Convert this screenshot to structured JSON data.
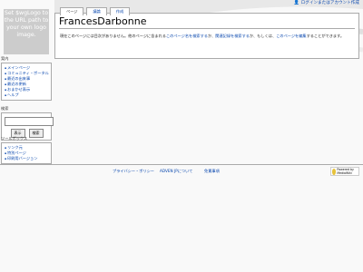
{
  "header": {
    "logo_text": "Set $wgLogo to the URL path to your own logo image.",
    "personal_login": "ログインまたはアカウント作成"
  },
  "tabs": [
    {
      "label": "ページ"
    },
    {
      "label": "議論"
    },
    {
      "label": "作成"
    }
  ],
  "content": {
    "title": "FrancesDarbonne",
    "text_1": "現在このページには目次がありません。他のページに含まれる",
    "link_search_title": "このページ名を検索する",
    "text_2": "か、",
    "link_logs": "関連記録を検索する",
    "text_3": "か、もしくは、",
    "link_edit": "このページを編集",
    "text_4": "することができます。"
  },
  "sidebar": {
    "navigation": {
      "heading": "案内",
      "items": [
        "メインページ",
        "コミュニティ・ポータル",
        "最近の出来事",
        "最近の更新",
        "おまかせ表示",
        "ヘルプ"
      ]
    },
    "search": {
      "heading": "検索",
      "value": "",
      "go": "表示",
      "search": "検索"
    },
    "toolbox": {
      "heading": "ツールボックス",
      "items": [
        "リンク元",
        "特別ページ",
        "印刷用バージョン"
      ]
    }
  },
  "footer": {
    "privacy": "プライバシー・ポリシー",
    "about": "ADVEN JPについて",
    "disclaimer": "免責事項",
    "powered_by": "Powered by MediaWiki"
  }
}
